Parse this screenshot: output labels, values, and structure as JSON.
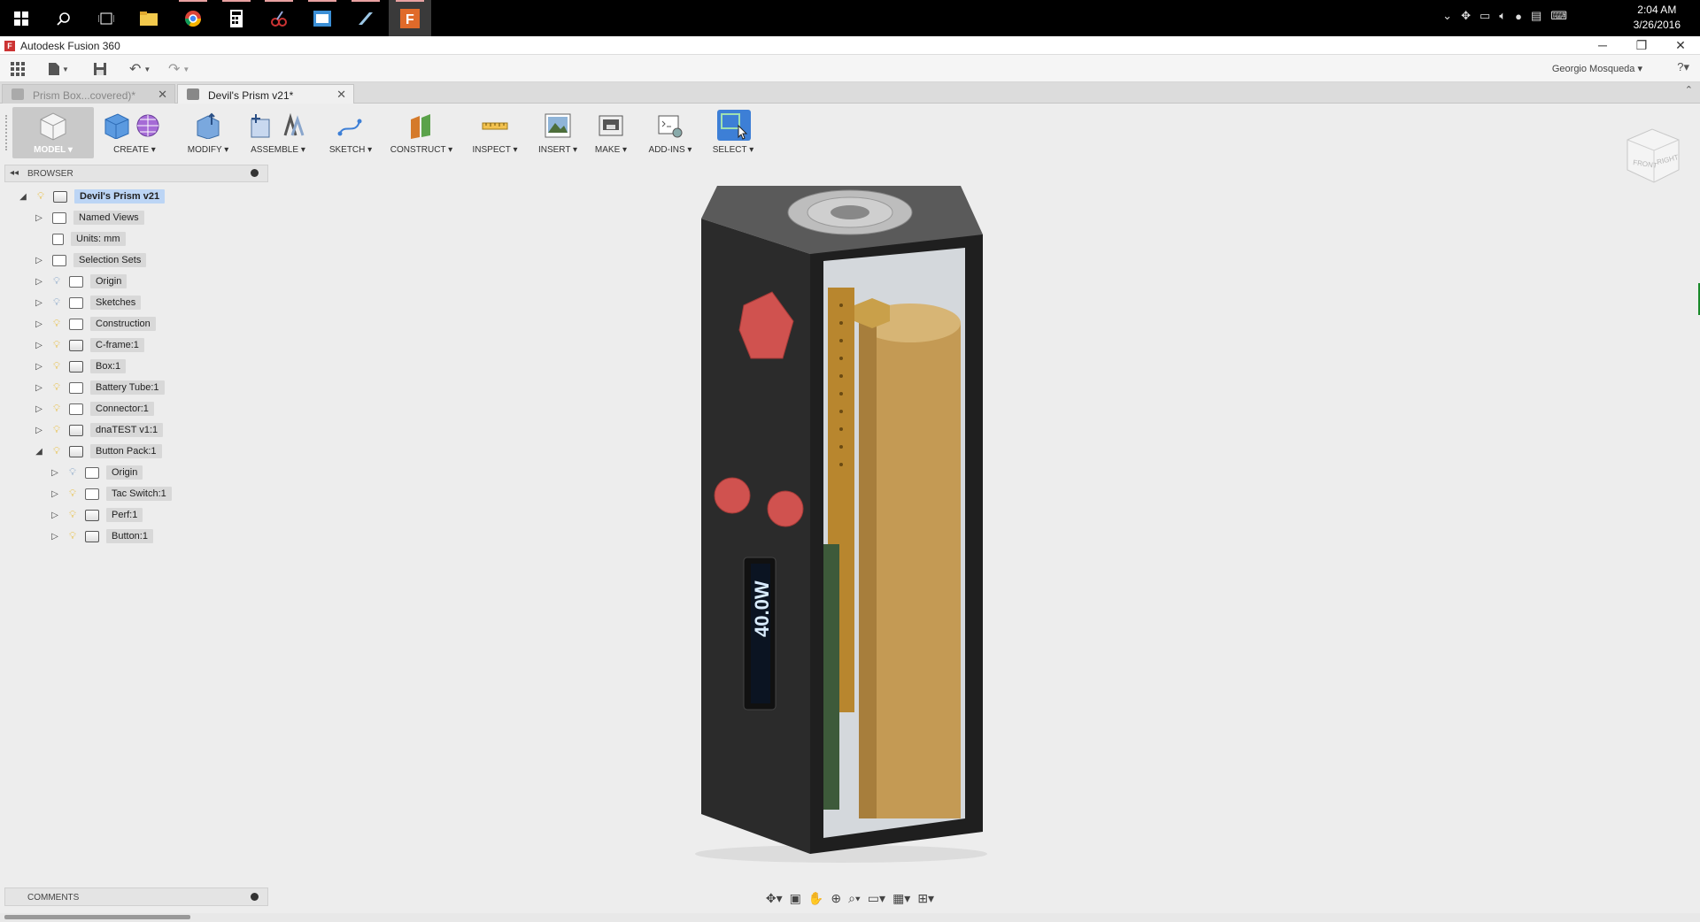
{
  "taskbar": {
    "clock_time": "2:04 AM",
    "clock_date": "3/26/2016",
    "icons": [
      "windows-start-icon",
      "search-icon",
      "task-view-icon",
      "file-explorer-icon",
      "chrome-icon",
      "calculator-icon",
      "snipping-tool-icon",
      "app-icon",
      "app-icon",
      "fusion-360-icon"
    ]
  },
  "window": {
    "title": "Autodesk Fusion 360",
    "logo_letter": "F",
    "min": "─",
    "max": "❐",
    "close": "✕"
  },
  "qat": {
    "user": "Georgio Mosqueda ▾",
    "help": "?▾"
  },
  "tabs": [
    {
      "label": "Prism Box...covered)*",
      "active": false,
      "close": "✕"
    },
    {
      "label": "Devil's Prism v21*",
      "active": true,
      "close": "✕"
    }
  ],
  "toolbar": {
    "model": "MODEL",
    "create": "CREATE",
    "modify": "MODIFY",
    "assemble": "ASSEMBLE",
    "sketch": "SKETCH",
    "construct": "CONSTRUCT",
    "inspect": "INSPECT",
    "insert": "INSERT",
    "make": "MAKE",
    "addins": "ADD-INS",
    "select": "SELECT"
  },
  "browser": {
    "header": "BROWSER",
    "root": "Devil's Prism v21",
    "items": [
      {
        "label": "Named Views"
      },
      {
        "label": "Units: mm"
      },
      {
        "label": "Selection Sets"
      },
      {
        "label": "Origin"
      },
      {
        "label": "Sketches"
      },
      {
        "label": "Construction"
      },
      {
        "label": "C-frame:1"
      },
      {
        "label": "Box:1"
      },
      {
        "label": "Battery Tube:1"
      },
      {
        "label": "Connector:1"
      },
      {
        "label": "dnaTEST v1:1"
      },
      {
        "label": "Button Pack:1"
      },
      {
        "label": "Origin"
      },
      {
        "label": "Tac Switch:1"
      },
      {
        "label": "Perf:1"
      },
      {
        "label": "Button:1"
      }
    ]
  },
  "comments": {
    "header": "COMMENTS"
  },
  "viewcube": {
    "front": "FRONT",
    "right": "RIGHT"
  },
  "model": {
    "display_text": "40.0W"
  },
  "colors": {
    "accent_blue": "#3d7fd6",
    "device_body": "#2a2a2a",
    "button_red": "#d0524f",
    "battery": "#c49a54"
  }
}
